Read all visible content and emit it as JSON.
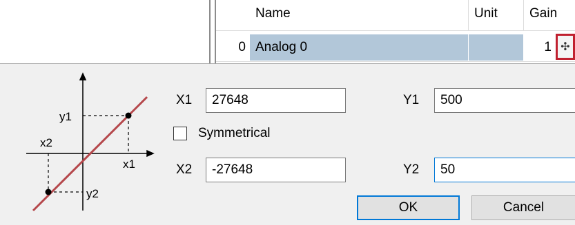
{
  "table": {
    "columns": [
      "Name",
      "Unit",
      "Gain"
    ],
    "rows": [
      {
        "index": "0",
        "name": "Analog 0",
        "unit": "",
        "gain": "1"
      }
    ],
    "gain_button_glyph": "✣",
    "gain_button_icon": "move-arrows-icon"
  },
  "dialog": {
    "diagram": {
      "y1": "y1",
      "x2": "x2",
      "x1": "x1",
      "y2": "y2",
      "line_color": "#b5474b"
    },
    "x1_label": "X1",
    "x1_value": "27648",
    "y1_label": "Y1",
    "y1_value": "500",
    "symmetrical_label": "Symmetrical",
    "symmetrical_checked": false,
    "x2_label": "X2",
    "x2_value": "-27648",
    "y2_label": "Y2",
    "y2_value": "50",
    "ok_label": "OK",
    "cancel_label": "Cancel"
  },
  "colors": {
    "selection": "#b2c7d9",
    "highlight_border": "#c0202f",
    "focus": "#0078d7"
  }
}
